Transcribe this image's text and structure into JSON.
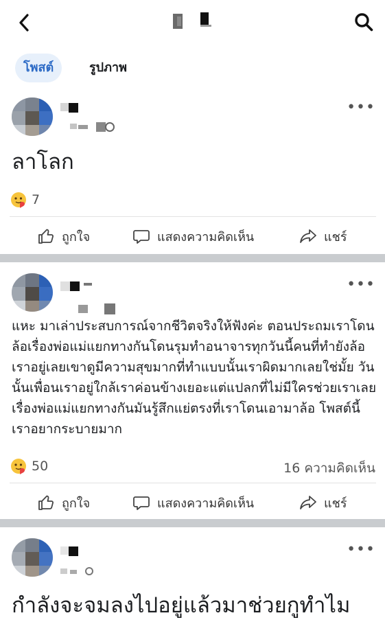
{
  "header": {
    "title": "",
    "back_icon": "back-chevron-icon",
    "search_icon": "search-icon"
  },
  "tabs": [
    {
      "label": "โพสต์",
      "active": true
    },
    {
      "label": "รูปภาพ",
      "active": false
    }
  ],
  "posts": [
    {
      "text": "ลาโลก",
      "reaction_count": "7",
      "comment_count": "",
      "actions": {
        "like": "ถูกใจ",
        "comment": "แสดงความคิดเห็น",
        "share": "แชร์"
      }
    },
    {
      "text": "แหะ มาเล่าประสบการณ์จากชีวิตจริงให้ฟังค่ะ ตอนประถมเราโดนล้อเรื่องพ่อแม่แยกทางกันโดนรุมทำอนาจารทุกวันนี้คนที่ทำยังล้อเราอยู่เลยเขาดูมีความสุขมากที่ทำแบบนั้นเราผิดมากเลยใช่มั้ย วันนั้นเพื่อนเราอยู่ใกล้เราค่อนข้างเยอะแต่แปลกที่ไม่มีใครช่วยเราเลยเรื่องพ่อแม่แยกทางกันมันรู้สึกแย่ตรงที่เราโดนเอามาล้อ โพสต์นี้เราอยากระบายมาก",
      "reaction_count": "50",
      "comment_count": "16 ความคิดเห็น",
      "actions": {
        "like": "ถูกใจ",
        "comment": "แสดงความคิดเห็น",
        "share": "แชร์"
      }
    },
    {
      "text": "กำลังจะจมลงไปอยู่แล้วมาช่วยกูทำไม",
      "reaction_count": "",
      "comment_count": ""
    }
  ],
  "colors": {
    "accent": "#2d6bc6",
    "tab_active_bg": "#e7f0fb",
    "separator": "#c9cccf",
    "text": "#1c1e21",
    "muted": "#555555"
  }
}
